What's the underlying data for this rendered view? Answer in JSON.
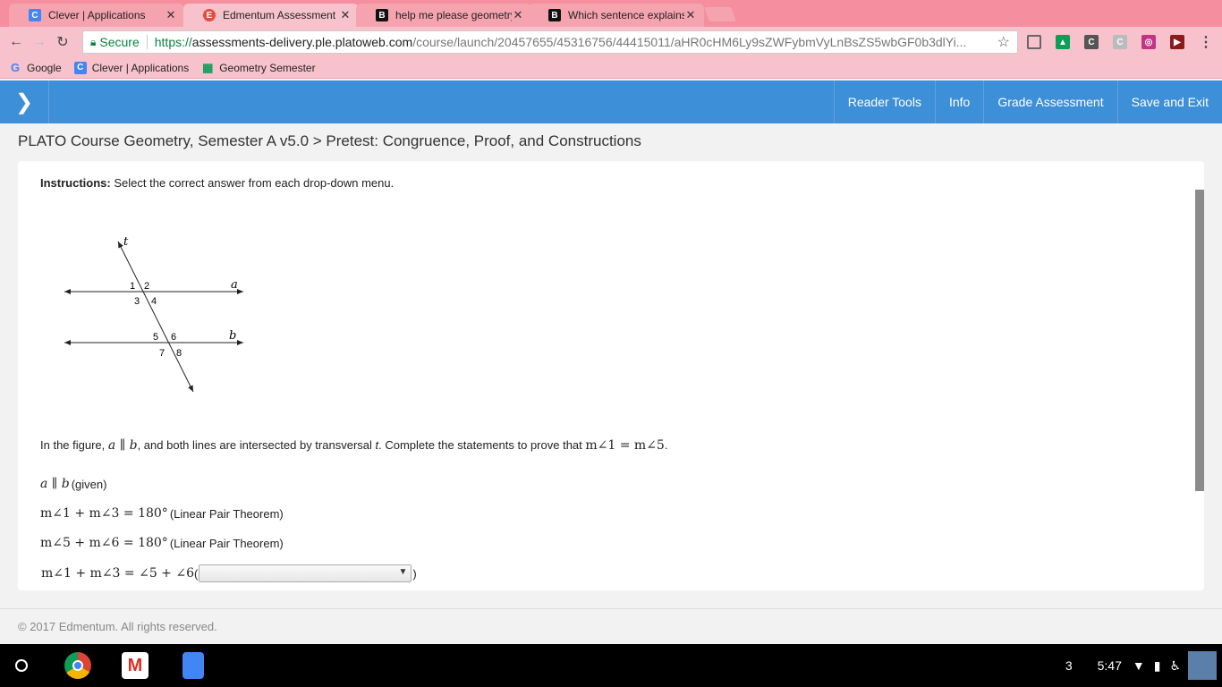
{
  "browser": {
    "tabs": [
      {
        "title": "Clever | Applications",
        "favicon": "C",
        "color": "#4285f4"
      },
      {
        "title": "Edmentum Assessment",
        "favicon": "E",
        "color": "#e34d3c"
      },
      {
        "title": "help me please geometry",
        "favicon": "B",
        "color": "#111111"
      },
      {
        "title": "Which sentence explains",
        "favicon": "B",
        "color": "#111111"
      }
    ],
    "secure_label": "Secure",
    "url_scheme": "https://",
    "url_host": "assessments-delivery.ple.platoweb.com",
    "url_path": "/course/launch/20457655/45316756/44415011/aHR0cHM6Ly9sZWFybmVyLnBsZS5wbGF0b3dlYi...",
    "bookmarks": [
      {
        "label": "Google",
        "icon": "G"
      },
      {
        "label": "Clever | Applications",
        "icon": "C"
      },
      {
        "label": "Geometry Semester",
        "icon": "▦"
      }
    ]
  },
  "app": {
    "menu": [
      "Reader Tools",
      "Info",
      "Grade Assessment",
      "Save and Exit"
    ],
    "breadcrumb": "PLATO Course Geometry, Semester A v5.0 > Pretest: Congruence, Proof, and Constructions"
  },
  "question": {
    "instructions_label": "Instructions:",
    "instructions_text": "Select the correct answer from each drop-down menu.",
    "figure_labels": {
      "t": "t",
      "a": "a",
      "b": "b",
      "angles": [
        "1",
        "2",
        "3",
        "4",
        "5",
        "6",
        "7",
        "8"
      ]
    },
    "prompt_start": "In the figure, ",
    "prompt_parallel": "a ∥ b",
    "prompt_mid": ", and both lines are intersected by transversal ",
    "prompt_t": "t",
    "prompt_end": ". Complete the  statements to prove that ",
    "prompt_goal": "m∠1 = m∠5",
    "prompt_period": ".",
    "statements": [
      {
        "math": "a ∥ b",
        "reason": "(given)"
      },
      {
        "math": "m∠1 + m∠3 = 180°",
        "reason": "(Linear Pair Theorem)"
      },
      {
        "math": "m∠5 + m∠6 = 180°",
        "reason": "(Linear Pair Theorem)"
      },
      {
        "math": "m∠1 + m∠3 = ∠5 + ∠6",
        "reason_open": "(",
        "reason_close": ")",
        "dropdown_value": ""
      }
    ]
  },
  "footer": "© 2017 Edmentum. All rights reserved.",
  "system": {
    "notification_count": "3",
    "time": "5:47"
  }
}
